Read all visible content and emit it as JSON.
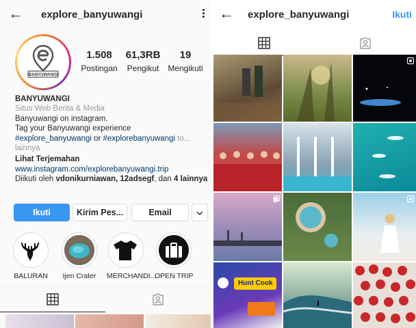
{
  "left": {
    "header": {
      "username": "explore_banyuwangi"
    },
    "avatar": {
      "logo_text": "BANYUWANGI"
    },
    "stats": [
      {
        "value": "1.508",
        "label": "Postingan"
      },
      {
        "value": "61,3RB",
        "label": "Pengikut"
      },
      {
        "value": "19",
        "label": "Mengikuti"
      }
    ],
    "bio": {
      "name": "BANYUWANGI",
      "category": "Situs Web Berita & Media",
      "line1": "Banyuwangi on instagram.",
      "line2": "Tag your Banyuwangi experience",
      "hashtag1": "#explore_banyuwangi",
      "or_text": " or ",
      "hashtag2": "#explorebanyuwangi",
      "to_text": " to...",
      "more": "lainnya",
      "translate": "Lihat Terjemahan",
      "website": "www.instagram.com/explorebanyuwangi.trip",
      "followed_prefix": "Diikuti oleh ",
      "followed_names": "vdonikurniawan, 12adsegf",
      "followed_mid": ", dan ",
      "followed_others": "4 lainnya"
    },
    "buttons": {
      "follow": "Ikuti",
      "message": "Kirim Pes...",
      "email": "Email"
    },
    "highlights": [
      {
        "label": "BALURAN",
        "icon": "deer-icon"
      },
      {
        "label": "Ijen Crater",
        "icon": "crater-icon"
      },
      {
        "label": "MERCHANDI...",
        "icon": "tshirt-icon"
      },
      {
        "label": "OPEN TRIP",
        "icon": "briefcase-icon"
      }
    ]
  },
  "right": {
    "header": {
      "username": "explore_banyuwangi",
      "follow": "Ikuti"
    },
    "posts": [
      {
        "type": "photo"
      },
      {
        "type": "photo"
      },
      {
        "type": "video"
      },
      {
        "type": "photo"
      },
      {
        "type": "photo"
      },
      {
        "type": "photo"
      },
      {
        "type": "carousel"
      },
      {
        "type": "photo"
      },
      {
        "type": "video"
      },
      {
        "type": "photo"
      },
      {
        "type": "photo"
      },
      {
        "type": "photo"
      }
    ],
    "post_texts": {
      "poster_title": "Hunt Cook"
    }
  },
  "colors": {
    "accent": "#3897f0",
    "text": "#262626",
    "link": "#00376b",
    "muted": "#999999"
  }
}
